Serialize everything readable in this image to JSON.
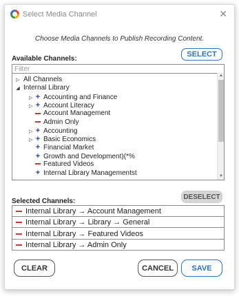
{
  "window": {
    "title": "Select Media Channel",
    "close_glyph": "✕"
  },
  "instructions": "Choose Media Channels to Publish Recording Content.",
  "available": {
    "label": "Available Channels:",
    "select_button": "SELECT",
    "filter_placeholder": "Filter",
    "tree": [
      {
        "label": "All Channels",
        "indent": 0,
        "icon": "collapsed-triangle"
      },
      {
        "label": "Internal  Library",
        "indent": 0,
        "icon": "expanded-triangle"
      },
      {
        "label": "Accounting and Finance",
        "indent": 1,
        "icon": "plus",
        "has_expander": true
      },
      {
        "label": "Account Literacy",
        "indent": 1,
        "icon": "plus",
        "has_expander": true
      },
      {
        "label": "Account Management",
        "indent": 1,
        "icon": "minus",
        "has_expander": false
      },
      {
        "label": "Admin Only",
        "indent": 1,
        "icon": "minus",
        "has_expander": false
      },
      {
        "label": "Accounting",
        "indent": 1,
        "icon": "plus",
        "has_expander": true
      },
      {
        "label": "Basic Economics",
        "indent": 1,
        "icon": "plus",
        "has_expander": true
      },
      {
        "label": "Financial Market",
        "indent": 1,
        "icon": "plus",
        "has_expander": false
      },
      {
        "label": "Growth and Development)(*%",
        "indent": 1,
        "icon": "plus",
        "has_expander": false
      },
      {
        "label": "Featured Videos",
        "indent": 1,
        "icon": "minus",
        "has_expander": false
      },
      {
        "label": "Internal Library Managementst",
        "indent": 1,
        "icon": "plus",
        "has_expander": false
      }
    ]
  },
  "selected": {
    "label": "Selected Channels:",
    "deselect_button": "DESELECT",
    "items": [
      {
        "label": "Internal  Library → Account Management"
      },
      {
        "label": "Internal  Library → Library → General"
      },
      {
        "label": "Internal  Library → Featured Videos"
      },
      {
        "label": "Internal  Library → Admin Only"
      }
    ]
  },
  "footer": {
    "clear_button": "CLEAR",
    "cancel_button": "CANCEL",
    "save_button": "SAVE"
  },
  "colors": {
    "accent": "#2a72c7",
    "remove": "#d23030",
    "add": "#2a3f8f",
    "disabled_button": "#d6d6d6"
  }
}
